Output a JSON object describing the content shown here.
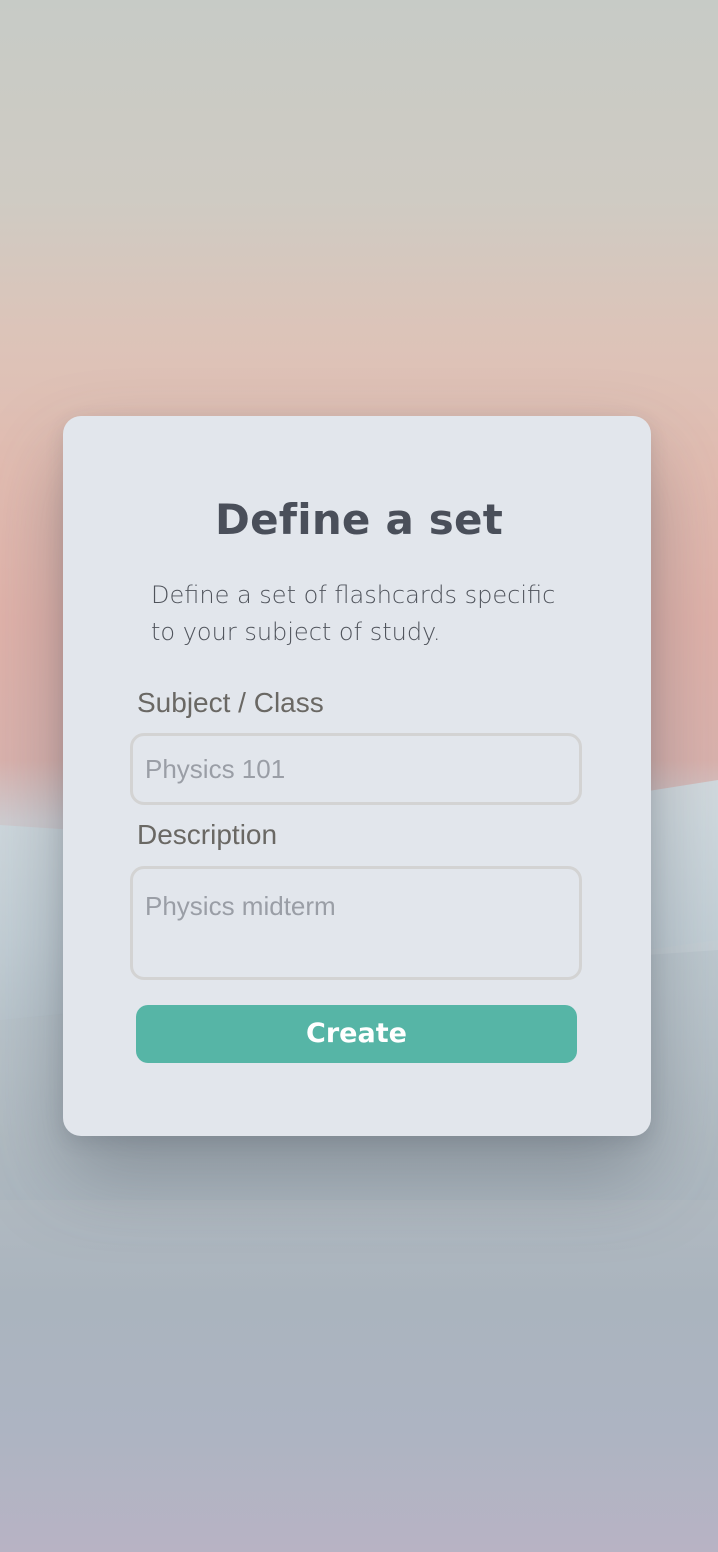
{
  "modal": {
    "title": "Define a set",
    "subtitle": "Define a set of flashcards specific to your subject of study.",
    "subject": {
      "label": "Subject / Class",
      "placeholder": "Physics 101",
      "value": ""
    },
    "description": {
      "label": "Description",
      "placeholder": "Physics midterm",
      "value": ""
    },
    "create_button": "Create"
  },
  "colors": {
    "accent": "#56b5a6",
    "card_bg": "#e2e6ec",
    "title_text": "#4a4f5a",
    "label_text": "#6a6864",
    "field_border": "#d3d3d3"
  }
}
